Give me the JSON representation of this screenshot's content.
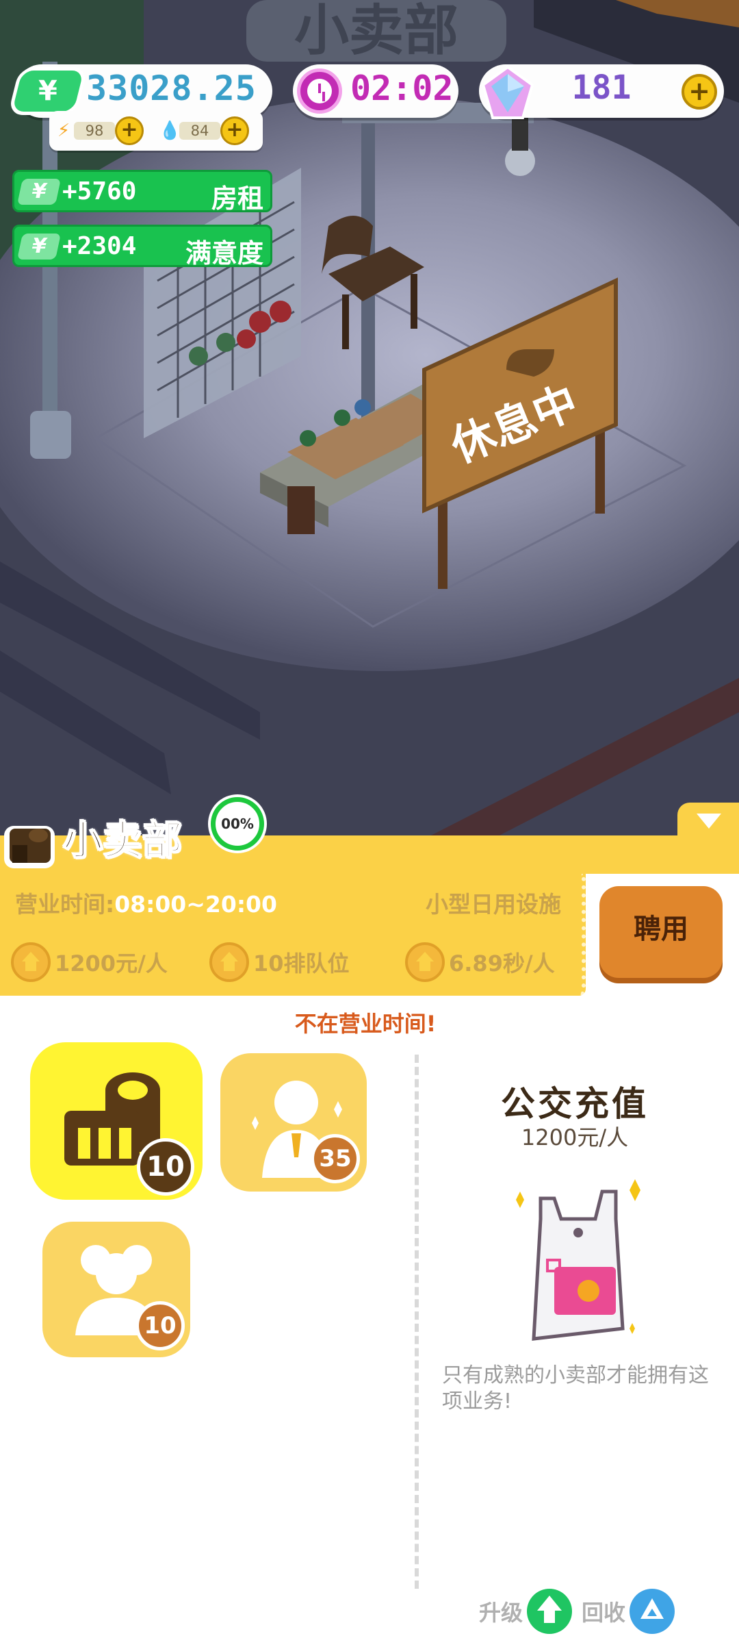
{
  "hud": {
    "money": "33028.25",
    "money_icon": "yen-cash-icon",
    "energy": "98",
    "water": "84",
    "timer": "02:02",
    "gems": "181",
    "plus_label": "+"
  },
  "scene": {
    "storefront_sign": "小卖部",
    "rest_sign": "休息中"
  },
  "income": [
    {
      "amount": "+5760",
      "label": "房租"
    },
    {
      "amount": "+2304",
      "label": "满意度"
    }
  ],
  "shop": {
    "title": "小卖部",
    "progress": "00%",
    "hours_label": "营业时间:",
    "hours_value": "08:00~20:00",
    "type": "小型日用设施",
    "stats": [
      "1200元/人",
      "10排队位",
      "6.89秒/人"
    ],
    "hire_label": "聘用",
    "notice": "不在营业时间!"
  },
  "upgrades": [
    {
      "name": "shop-goods",
      "level": "10"
    },
    {
      "name": "staff",
      "level": "35"
    },
    {
      "name": "queue",
      "level": "10"
    }
  ],
  "service": {
    "title": "公交充值",
    "price": "1200元/人",
    "note": "只有成熟的小卖部才能拥有这项业务!"
  },
  "footer": {
    "upgrade_label": "升级",
    "recycle_label": "回收"
  },
  "colors": {
    "panel_yellow": "#fbd147",
    "money_green": "#19c24f",
    "hire_orange": "#e0862c",
    "notice_red": "#d85a1c"
  }
}
